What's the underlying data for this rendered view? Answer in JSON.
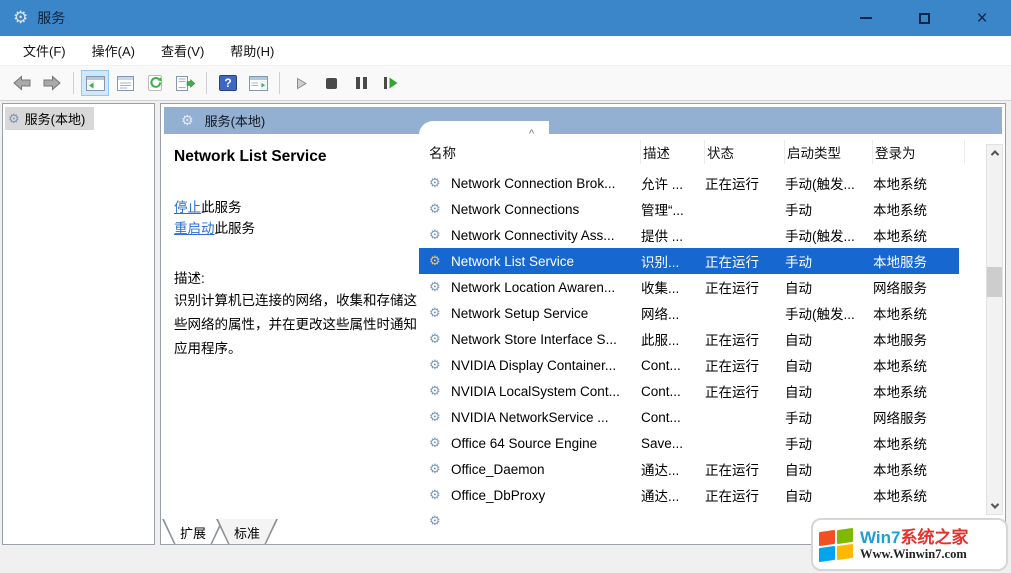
{
  "window": {
    "title": "服务"
  },
  "menu": {
    "items": [
      {
        "label": "文件(F)"
      },
      {
        "label": "操作(A)"
      },
      {
        "label": "查看(V)"
      },
      {
        "label": "帮助(H)"
      }
    ]
  },
  "toolbar": {
    "icons": [
      "back-icon",
      "forward-icon",
      "show-console-tree-icon",
      "properties-icon",
      "refresh-icon",
      "export-list-icon",
      "help-icon",
      "show-action-pane-icon",
      "start-service-icon",
      "stop-service-icon",
      "pause-service-icon",
      "restart-service-icon"
    ],
    "help_glyph": "?"
  },
  "tree": {
    "items": [
      {
        "label": "服务(本地)",
        "selected": true
      }
    ]
  },
  "detail": {
    "header_title": "服务(本地)",
    "service_name": "Network List Service",
    "actions": [
      {
        "link": "停止",
        "suffix": "此服务"
      },
      {
        "link": "重启动",
        "suffix": "此服务"
      }
    ],
    "description_label": "描述:",
    "description": "识别计算机已连接的网络，收集和存储这些网络的属性，并在更改这些属性时通知应用程序。"
  },
  "table": {
    "columns": [
      "名称",
      "描述",
      "状态",
      "启动类型",
      "登录为"
    ],
    "sort_column": "名称",
    "sort_indicator": "^",
    "rows": [
      {
        "name": "Network Connection Brok...",
        "desc": "允许 ...",
        "status": "正在运行",
        "startup": "手动(触发...",
        "logon": "本地系统",
        "selected": false
      },
      {
        "name": "Network Connections",
        "desc": "管理“...",
        "status": "",
        "startup": "手动",
        "logon": "本地系统",
        "selected": false
      },
      {
        "name": "Network Connectivity Ass...",
        "desc": "提供 ...",
        "status": "",
        "startup": "手动(触发...",
        "logon": "本地系统",
        "selected": false
      },
      {
        "name": "Network List Service",
        "desc": "识别...",
        "status": "正在运行",
        "startup": "手动",
        "logon": "本地服务",
        "selected": true
      },
      {
        "name": "Network Location Awaren...",
        "desc": "收集...",
        "status": "正在运行",
        "startup": "自动",
        "logon": "网络服务",
        "selected": false
      },
      {
        "name": "Network Setup Service",
        "desc": "网络...",
        "status": "",
        "startup": "手动(触发...",
        "logon": "本地系统",
        "selected": false
      },
      {
        "name": "Network Store Interface S...",
        "desc": "此服...",
        "status": "正在运行",
        "startup": "自动",
        "logon": "本地服务",
        "selected": false
      },
      {
        "name": "NVIDIA Display Container...",
        "desc": "Cont...",
        "status": "正在运行",
        "startup": "自动",
        "logon": "本地系统",
        "selected": false
      },
      {
        "name": "NVIDIA LocalSystem Cont...",
        "desc": "Cont...",
        "status": "正在运行",
        "startup": "自动",
        "logon": "本地系统",
        "selected": false
      },
      {
        "name": "NVIDIA NetworkService ...",
        "desc": "Cont...",
        "status": "",
        "startup": "手动",
        "logon": "网络服务",
        "selected": false
      },
      {
        "name": "Office 64 Source Engine",
        "desc": "Save...",
        "status": "",
        "startup": "手动",
        "logon": "本地系统",
        "selected": false
      },
      {
        "name": "Office_Daemon",
        "desc": "通达...",
        "status": "正在运行",
        "startup": "自动",
        "logon": "本地系统",
        "selected": false
      },
      {
        "name": "Office_DbProxy",
        "desc": "通达...",
        "status": "正在运行",
        "startup": "自动",
        "logon": "本地系统",
        "selected": false
      },
      {
        "name": "",
        "desc": "",
        "status": "",
        "startup": "",
        "logon": "",
        "selected": false,
        "partial": true
      }
    ]
  },
  "tabs": [
    {
      "label": "扩展",
      "active": true
    },
    {
      "label": "标准",
      "active": false
    }
  ],
  "watermark": {
    "brand_primary": "Win7",
    "brand_secondary": "系统之家",
    "site": "Www.Winwin7.com"
  },
  "colors": {
    "titlebar": "#3b86c8",
    "band": "#93b0d3",
    "selection": "#1667cf",
    "link": "#2a6fd2"
  }
}
